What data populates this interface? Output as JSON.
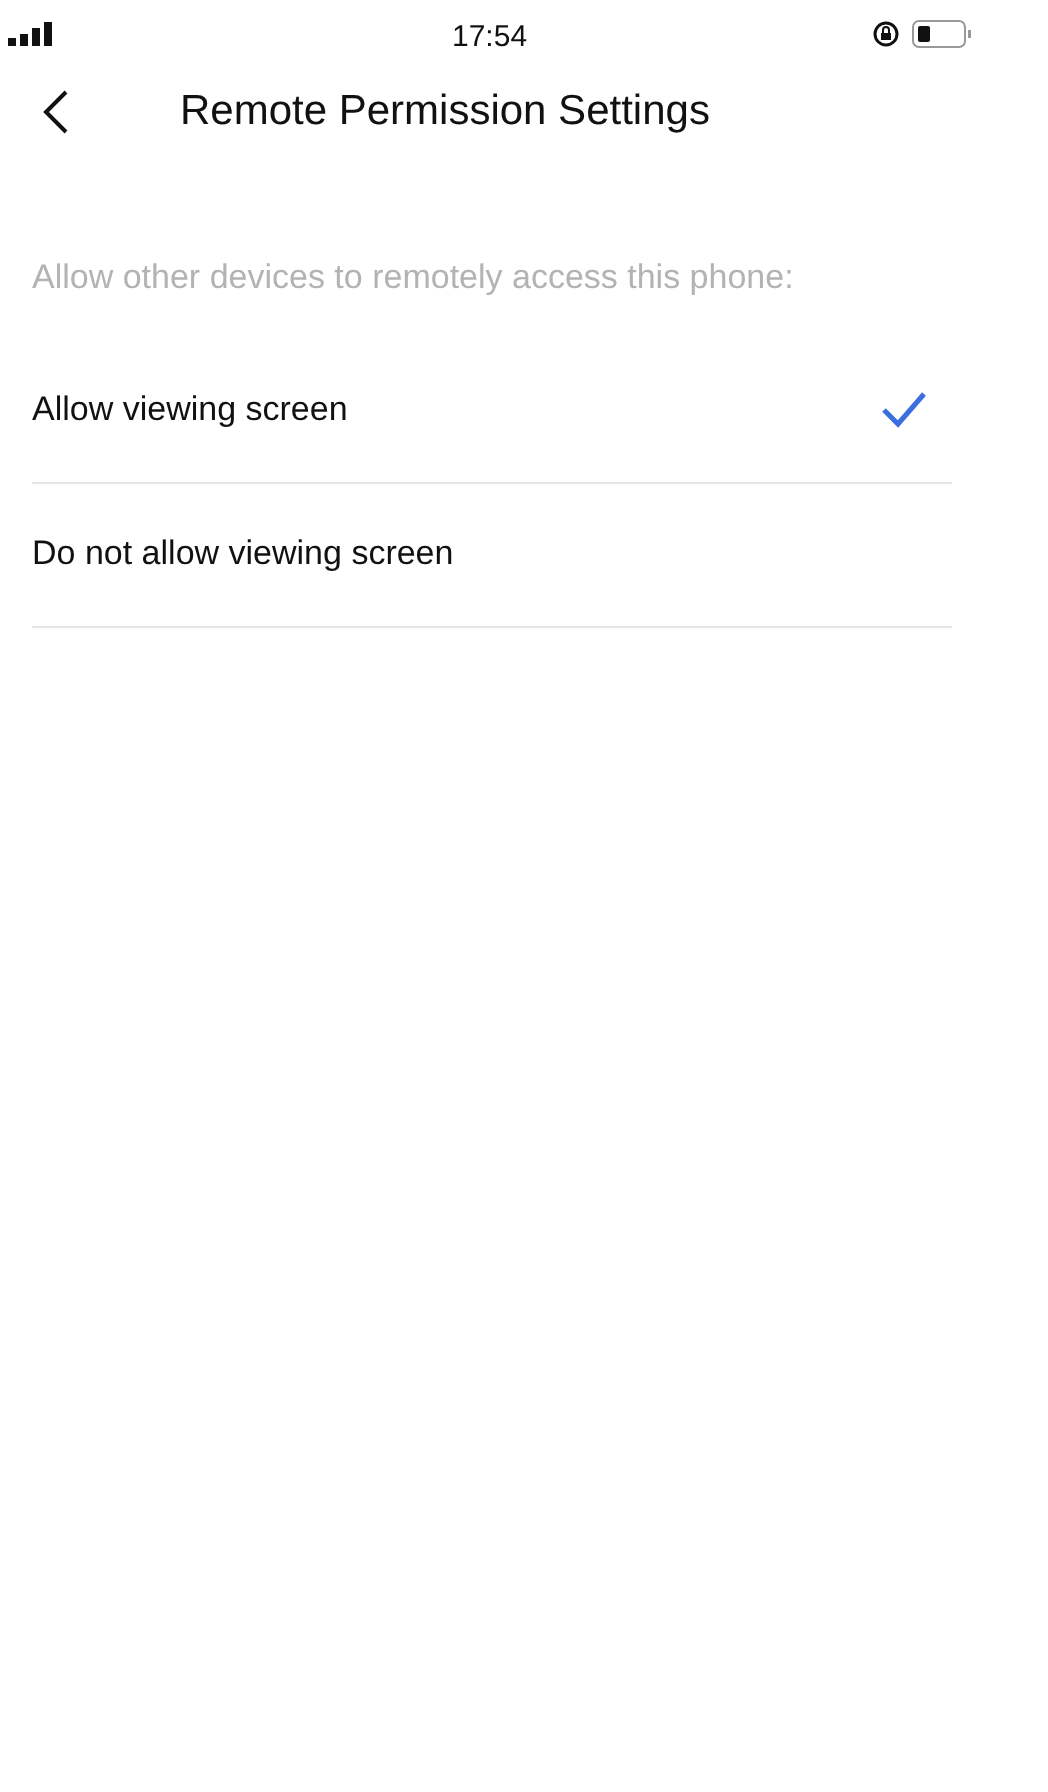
{
  "status_bar": {
    "time": "17:54"
  },
  "header": {
    "title": "Remote Permission Settings"
  },
  "section": {
    "caption": "Allow other devices to remotely access this phone:"
  },
  "options": [
    {
      "label": "Allow viewing screen",
      "selected": true
    },
    {
      "label": "Do not allow viewing screen",
      "selected": false
    }
  ]
}
